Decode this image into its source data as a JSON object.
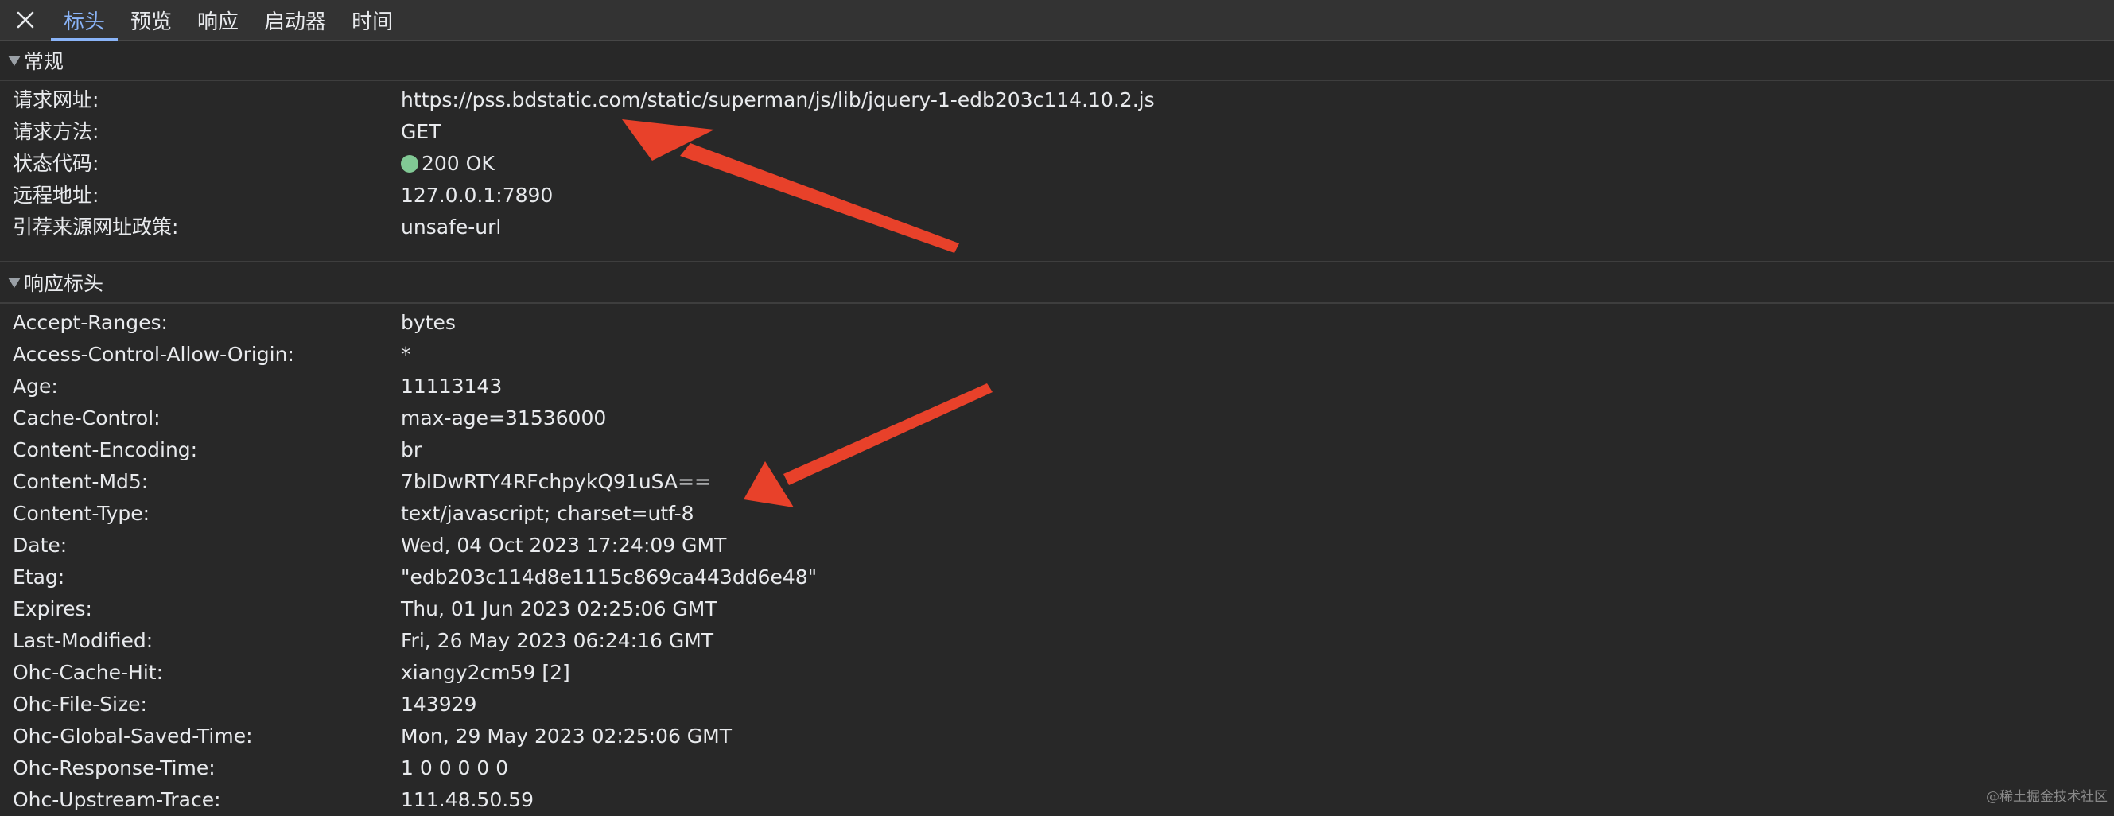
{
  "toolbar": {
    "close_icon": "close-icon",
    "tabs": [
      {
        "label": "标头",
        "active": true
      },
      {
        "label": "预览",
        "active": false
      },
      {
        "label": "响应",
        "active": false
      },
      {
        "label": "启动器",
        "active": false
      },
      {
        "label": "时间",
        "active": false
      }
    ]
  },
  "general": {
    "title": "常规",
    "rows": [
      {
        "key": "请求网址:",
        "value": "https://pss.bdstatic.com/static/superman/js/lib/jquery-1-edb203c114.10.2.js"
      },
      {
        "key": "请求方法:",
        "value": "GET"
      },
      {
        "key": "状态代码:",
        "value": "200 OK"
      },
      {
        "key": "远程地址:",
        "value": "127.0.0.1:7890"
      },
      {
        "key": "引荐来源网址政策:",
        "value": "unsafe-url"
      }
    ]
  },
  "response_headers": {
    "title": "响应标头",
    "rows": [
      {
        "key": "Accept-Ranges:",
        "value": "bytes"
      },
      {
        "key": "Access-Control-Allow-Origin:",
        "value": "*"
      },
      {
        "key": "Age:",
        "value": "11113143"
      },
      {
        "key": "Cache-Control:",
        "value": "max-age=31536000"
      },
      {
        "key": "Content-Encoding:",
        "value": "br"
      },
      {
        "key": "Content-Md5:",
        "value": "7bIDwRTY4RFchpykQ91uSA=="
      },
      {
        "key": "Content-Type:",
        "value": "text/javascript; charset=utf-8"
      },
      {
        "key": "Date:",
        "value": "Wed, 04 Oct 2023 17:24:09 GMT"
      },
      {
        "key": "Etag:",
        "value": "\"edb203c114d8e1115c869ca443dd6e48\""
      },
      {
        "key": "Expires:",
        "value": "Thu, 01 Jun 2023 02:25:06 GMT"
      },
      {
        "key": "Last-Modified:",
        "value": "Fri, 26 May 2023 06:24:16 GMT"
      },
      {
        "key": "Ohc-Cache-Hit:",
        "value": "xiangy2cm59 [2]"
      },
      {
        "key": "Ohc-File-Size:",
        "value": "143929"
      },
      {
        "key": "Ohc-Global-Saved-Time:",
        "value": "Mon, 29 May 2023 02:25:06 GMT"
      },
      {
        "key": "Ohc-Response-Time:",
        "value": "1 0 0 0 0 0"
      },
      {
        "key": "Ohc-Upstream-Trace:",
        "value": "111.48.50.59"
      }
    ]
  },
  "colors": {
    "background": "#282828",
    "active_tab": "#8ab4f8",
    "status_ok": "#81c995",
    "annotation_arrow": "#e8412a"
  },
  "watermark": "@稀土掘金技术社区"
}
